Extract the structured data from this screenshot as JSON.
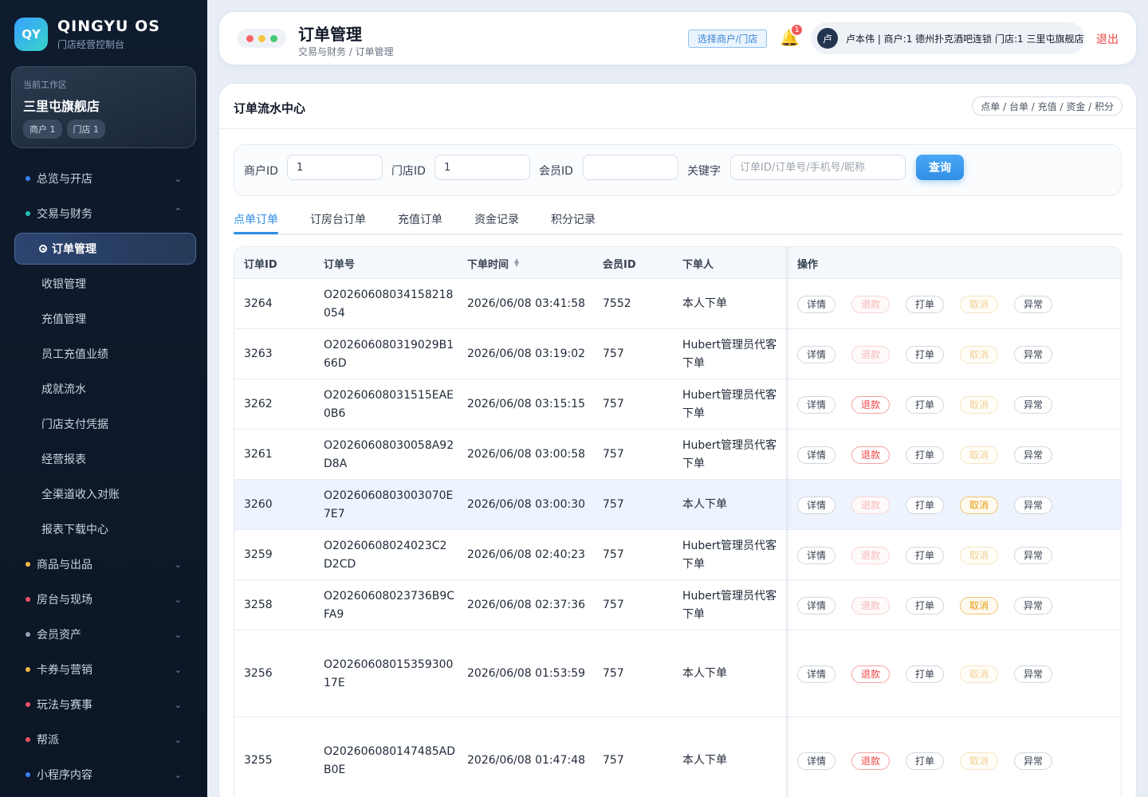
{
  "brand": {
    "logo": "QY",
    "name": "QINGYU OS",
    "subtitle": "门店经营控制台"
  },
  "workspace": {
    "label": "当前工作区",
    "name": "三里屯旗舰店",
    "tags": [
      "商户 1",
      "门店 1"
    ]
  },
  "nav": {
    "groups": [
      {
        "label": "总览与开店",
        "dot": "#3b82f6"
      },
      {
        "label": "交易与财务",
        "dot": "#22c5b5"
      },
      {
        "label": "商品与出品",
        "dot": "#f5b942"
      },
      {
        "label": "房台与现场",
        "dot": "#f0526a"
      },
      {
        "label": "会员资产",
        "dot": "#94a3b8"
      },
      {
        "label": "卡券与营销",
        "dot": "#f5b942"
      },
      {
        "label": "玩法与赛事",
        "dot": "#f0526a"
      },
      {
        "label": "帮派",
        "dot": "#f0526a"
      },
      {
        "label": "小程序内容",
        "dot": "#3b82f6"
      }
    ],
    "active": "订单管理",
    "subitems": [
      "收银管理",
      "充值管理",
      "员工充值业绩",
      "成就流水",
      "门店支付凭据",
      "经营报表",
      "全渠道收入对账",
      "报表下载中心"
    ]
  },
  "header": {
    "title": "订单管理",
    "breadcrumb": "交易与财务 / 订单管理",
    "select_button": "选择商户/门店",
    "bell_count": "1",
    "avatar": "卢",
    "user_info": "卢本伟 | 商户:1 德州扑克酒吧连锁 门店:1 三里屯旗舰店",
    "logout": "退出"
  },
  "card": {
    "title": "订单流水中心",
    "tags": "点单 / 台单 / 充值 / 资金 / 积分"
  },
  "filter": {
    "merchant_label": "商户ID",
    "merchant_value": "1",
    "store_label": "门店ID",
    "store_value": "1",
    "member_label": "会员ID",
    "member_value": "",
    "keyword_label": "关键字",
    "keyword_placeholder": "订单ID/订单号/手机号/昵称",
    "query_button": "查询"
  },
  "tabs": [
    "点单订单",
    "订房台订单",
    "充值订单",
    "资金记录",
    "积分记录"
  ],
  "table": {
    "columns": [
      "订单ID",
      "订单号",
      "下单时间",
      "会员ID",
      "下单人",
      "操作"
    ],
    "actions": [
      "详情",
      "退款",
      "打单",
      "取消",
      "异常"
    ],
    "rows": [
      {
        "id": "3264",
        "no1": "O20260608034158218",
        "no2": "054",
        "time": "2026/06/08 03:41:58",
        "member": "7552",
        "by1": "本人下单",
        "by2": "",
        "refund": false,
        "cancel": false
      },
      {
        "id": "3263",
        "no1": "O202606080319029B1",
        "no2": "66D",
        "time": "2026/06/08 03:19:02",
        "member": "757",
        "by1": "Hubert管理员代客",
        "by2": "下单",
        "refund": false,
        "cancel": false
      },
      {
        "id": "3262",
        "no1": "O20260608031515EAE",
        "no2": "0B6",
        "time": "2026/06/08 03:15:15",
        "member": "757",
        "by1": "Hubert管理员代客",
        "by2": "下单",
        "refund": true,
        "cancel": false
      },
      {
        "id": "3261",
        "no1": "O20260608030058A92",
        "no2": "D8A",
        "time": "2026/06/08 03:00:58",
        "member": "757",
        "by1": "Hubert管理员代客",
        "by2": "下单",
        "refund": true,
        "cancel": false
      },
      {
        "id": "3260",
        "no1": "O2026060803003070E",
        "no2": "7E7",
        "time": "2026/06/08 03:00:30",
        "member": "757",
        "by1": "本人下单",
        "by2": "",
        "refund": false,
        "cancel": true
      },
      {
        "id": "3259",
        "no1": "O20260608024023C2",
        "no2": "D2CD",
        "time": "2026/06/08 02:40:23",
        "member": "757",
        "by1": "Hubert管理员代客",
        "by2": "下单",
        "refund": false,
        "cancel": false
      },
      {
        "id": "3258",
        "no1": "O20260608023736B9C",
        "no2": "FA9",
        "time": "2026/06/08 02:37:36",
        "member": "757",
        "by1": "Hubert管理员代客",
        "by2": "下单",
        "refund": false,
        "cancel": true
      },
      {
        "id": "3256",
        "no1": "O202606080153593​00",
        "no2": "17E",
        "time": "2026/06/08 01:53:59",
        "member": "757",
        "by1": "本人下单",
        "by2": "",
        "refund": true,
        "cancel": false
      },
      {
        "id": "3255",
        "no1": "O202606080147485AD",
        "no2": "B0E",
        "time": "2026/06/08 01:47:48",
        "member": "757",
        "by1": "本人下单",
        "by2": "",
        "refund": true,
        "cancel": false
      }
    ]
  }
}
